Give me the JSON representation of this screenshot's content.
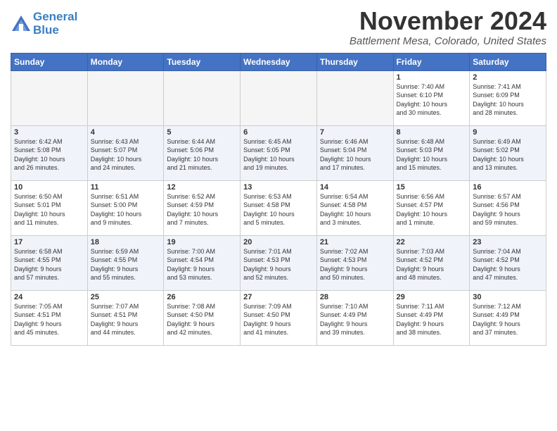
{
  "header": {
    "logo_line1": "General",
    "logo_line2": "Blue",
    "month_title": "November 2024",
    "location": "Battlement Mesa, Colorado, United States"
  },
  "weekdays": [
    "Sunday",
    "Monday",
    "Tuesday",
    "Wednesday",
    "Thursday",
    "Friday",
    "Saturday"
  ],
  "weeks": [
    [
      {
        "num": "",
        "info": ""
      },
      {
        "num": "",
        "info": ""
      },
      {
        "num": "",
        "info": ""
      },
      {
        "num": "",
        "info": ""
      },
      {
        "num": "",
        "info": ""
      },
      {
        "num": "1",
        "info": "Sunrise: 7:40 AM\nSunset: 6:10 PM\nDaylight: 10 hours\nand 30 minutes."
      },
      {
        "num": "2",
        "info": "Sunrise: 7:41 AM\nSunset: 6:09 PM\nDaylight: 10 hours\nand 28 minutes."
      }
    ],
    [
      {
        "num": "3",
        "info": "Sunrise: 6:42 AM\nSunset: 5:08 PM\nDaylight: 10 hours\nand 26 minutes."
      },
      {
        "num": "4",
        "info": "Sunrise: 6:43 AM\nSunset: 5:07 PM\nDaylight: 10 hours\nand 24 minutes."
      },
      {
        "num": "5",
        "info": "Sunrise: 6:44 AM\nSunset: 5:06 PM\nDaylight: 10 hours\nand 21 minutes."
      },
      {
        "num": "6",
        "info": "Sunrise: 6:45 AM\nSunset: 5:05 PM\nDaylight: 10 hours\nand 19 minutes."
      },
      {
        "num": "7",
        "info": "Sunrise: 6:46 AM\nSunset: 5:04 PM\nDaylight: 10 hours\nand 17 minutes."
      },
      {
        "num": "8",
        "info": "Sunrise: 6:48 AM\nSunset: 5:03 PM\nDaylight: 10 hours\nand 15 minutes."
      },
      {
        "num": "9",
        "info": "Sunrise: 6:49 AM\nSunset: 5:02 PM\nDaylight: 10 hours\nand 13 minutes."
      }
    ],
    [
      {
        "num": "10",
        "info": "Sunrise: 6:50 AM\nSunset: 5:01 PM\nDaylight: 10 hours\nand 11 minutes."
      },
      {
        "num": "11",
        "info": "Sunrise: 6:51 AM\nSunset: 5:00 PM\nDaylight: 10 hours\nand 9 minutes."
      },
      {
        "num": "12",
        "info": "Sunrise: 6:52 AM\nSunset: 4:59 PM\nDaylight: 10 hours\nand 7 minutes."
      },
      {
        "num": "13",
        "info": "Sunrise: 6:53 AM\nSunset: 4:58 PM\nDaylight: 10 hours\nand 5 minutes."
      },
      {
        "num": "14",
        "info": "Sunrise: 6:54 AM\nSunset: 4:58 PM\nDaylight: 10 hours\nand 3 minutes."
      },
      {
        "num": "15",
        "info": "Sunrise: 6:56 AM\nSunset: 4:57 PM\nDaylight: 10 hours\nand 1 minute."
      },
      {
        "num": "16",
        "info": "Sunrise: 6:57 AM\nSunset: 4:56 PM\nDaylight: 9 hours\nand 59 minutes."
      }
    ],
    [
      {
        "num": "17",
        "info": "Sunrise: 6:58 AM\nSunset: 4:55 PM\nDaylight: 9 hours\nand 57 minutes."
      },
      {
        "num": "18",
        "info": "Sunrise: 6:59 AM\nSunset: 4:55 PM\nDaylight: 9 hours\nand 55 minutes."
      },
      {
        "num": "19",
        "info": "Sunrise: 7:00 AM\nSunset: 4:54 PM\nDaylight: 9 hours\nand 53 minutes."
      },
      {
        "num": "20",
        "info": "Sunrise: 7:01 AM\nSunset: 4:53 PM\nDaylight: 9 hours\nand 52 minutes."
      },
      {
        "num": "21",
        "info": "Sunrise: 7:02 AM\nSunset: 4:53 PM\nDaylight: 9 hours\nand 50 minutes."
      },
      {
        "num": "22",
        "info": "Sunrise: 7:03 AM\nSunset: 4:52 PM\nDaylight: 9 hours\nand 48 minutes."
      },
      {
        "num": "23",
        "info": "Sunrise: 7:04 AM\nSunset: 4:52 PM\nDaylight: 9 hours\nand 47 minutes."
      }
    ],
    [
      {
        "num": "24",
        "info": "Sunrise: 7:05 AM\nSunset: 4:51 PM\nDaylight: 9 hours\nand 45 minutes."
      },
      {
        "num": "25",
        "info": "Sunrise: 7:07 AM\nSunset: 4:51 PM\nDaylight: 9 hours\nand 44 minutes."
      },
      {
        "num": "26",
        "info": "Sunrise: 7:08 AM\nSunset: 4:50 PM\nDaylight: 9 hours\nand 42 minutes."
      },
      {
        "num": "27",
        "info": "Sunrise: 7:09 AM\nSunset: 4:50 PM\nDaylight: 9 hours\nand 41 minutes."
      },
      {
        "num": "28",
        "info": "Sunrise: 7:10 AM\nSunset: 4:49 PM\nDaylight: 9 hours\nand 39 minutes."
      },
      {
        "num": "29",
        "info": "Sunrise: 7:11 AM\nSunset: 4:49 PM\nDaylight: 9 hours\nand 38 minutes."
      },
      {
        "num": "30",
        "info": "Sunrise: 7:12 AM\nSunset: 4:49 PM\nDaylight: 9 hours\nand 37 minutes."
      }
    ]
  ]
}
